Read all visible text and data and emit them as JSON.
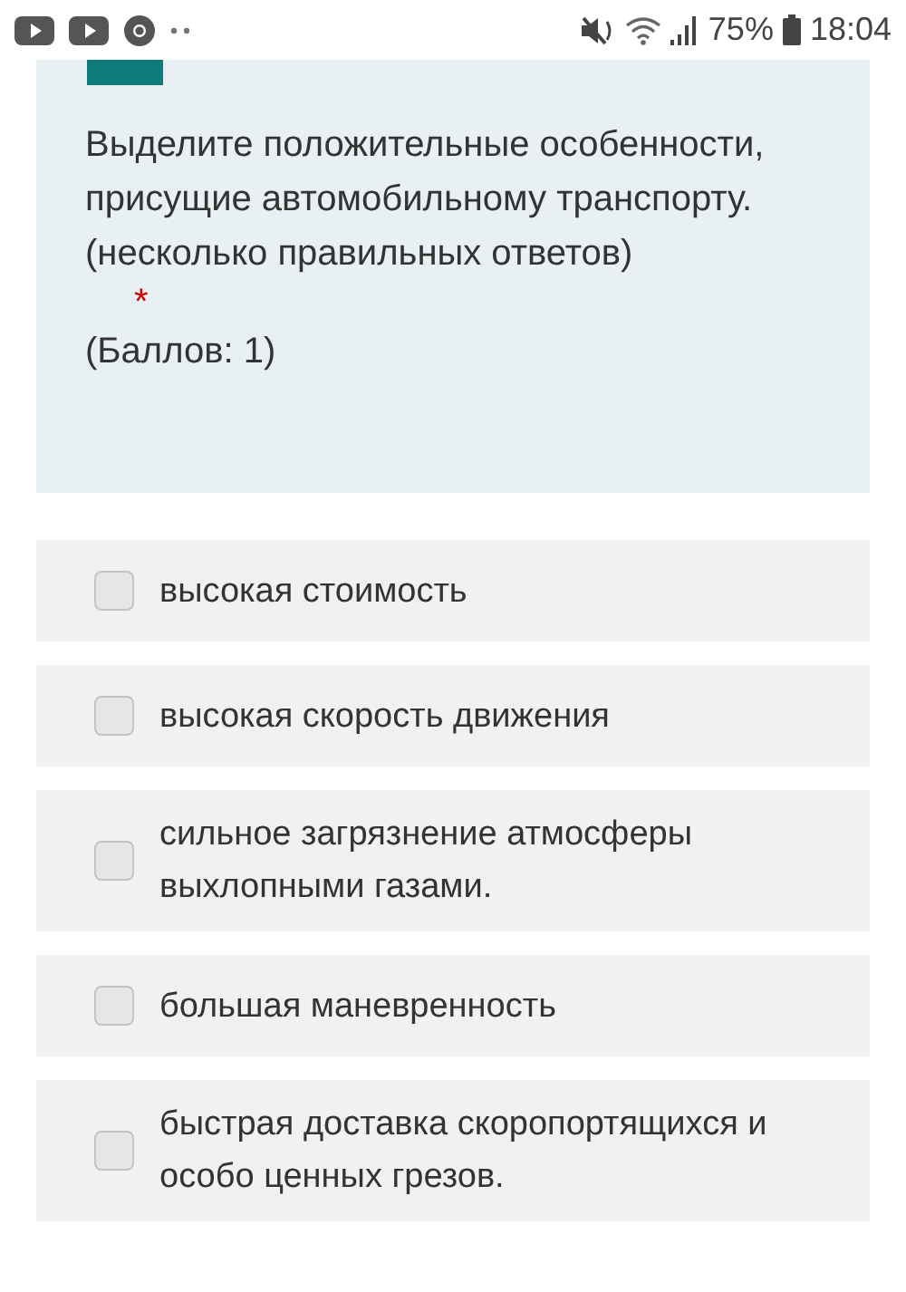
{
  "status_bar": {
    "battery": "75%",
    "time": "18:04"
  },
  "question": {
    "text": "Выделите положительные особенности, присущие автомобильному транспорту. (несколько правильных ответов)",
    "required_mark": "*",
    "points": "(Баллов: 1)"
  },
  "options": [
    {
      "label": "высокая стоимость",
      "checked": false
    },
    {
      "label": "высокая скорость движения",
      "checked": false
    },
    {
      "label": "сильное загрязнение атмосферы выхлопными газами.",
      "checked": false
    },
    {
      "label": "большая маневренность",
      "checked": false
    },
    {
      "label": "быстрая доставка скоропортящихся и особо ценных грезов.",
      "checked": false
    }
  ]
}
